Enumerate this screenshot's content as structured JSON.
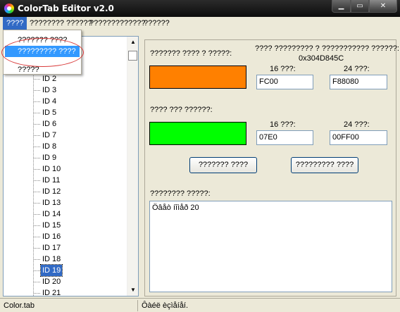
{
  "window": {
    "title": "ColorTab Editor v2.0"
  },
  "menu": [
    {
      "label": "????"
    },
    {
      "label": "???????? ??????"
    },
    {
      "label": "?????????????"
    },
    {
      "label": "??????"
    }
  ],
  "menu_dropdown": {
    "items": [
      {
        "label": "??????? ????"
      },
      {
        "label": "????????? ????"
      },
      {
        "label": "?????"
      }
    ]
  },
  "tree": {
    "items": [
      "ID 2",
      "ID 3",
      "ID 4",
      "ID 5",
      "ID 6",
      "ID 7",
      "ID 8",
      "ID 9",
      "ID 10",
      "ID 11",
      "ID 12",
      "ID 13",
      "ID 14",
      "ID 15",
      "ID 16",
      "ID 17",
      "ID 18",
      "ID 19",
      "ID 20",
      "ID 21"
    ],
    "selected": "ID 19"
  },
  "editor": {
    "current_color_label": "??????? ???? ? ?????:",
    "address_label": "???? ????????? ? ??????????? ??????:",
    "address_value": "0x304D845C",
    "current": {
      "hex16_label": "16 ???:",
      "hex16": "FC00",
      "hex24_label": "24 ???:",
      "hex24": "F88080",
      "swatch_color": "#ff8000"
    },
    "new_color_label": "???? ??? ??????:",
    "new": {
      "hex16_label": "16 ???:",
      "hex16": "07E0",
      "hex24_label": "24 ???:",
      "hex24": "00FF00",
      "swatch_color": "#00ff00"
    },
    "button_left": "??????? ????",
    "button_right": "????????? ????",
    "description_label": "???????? ?????:",
    "description_text": "Öâåò íîìåð 20"
  },
  "status": {
    "left": "Color.tab",
    "right": "Ôàéë èçìåíåí."
  }
}
